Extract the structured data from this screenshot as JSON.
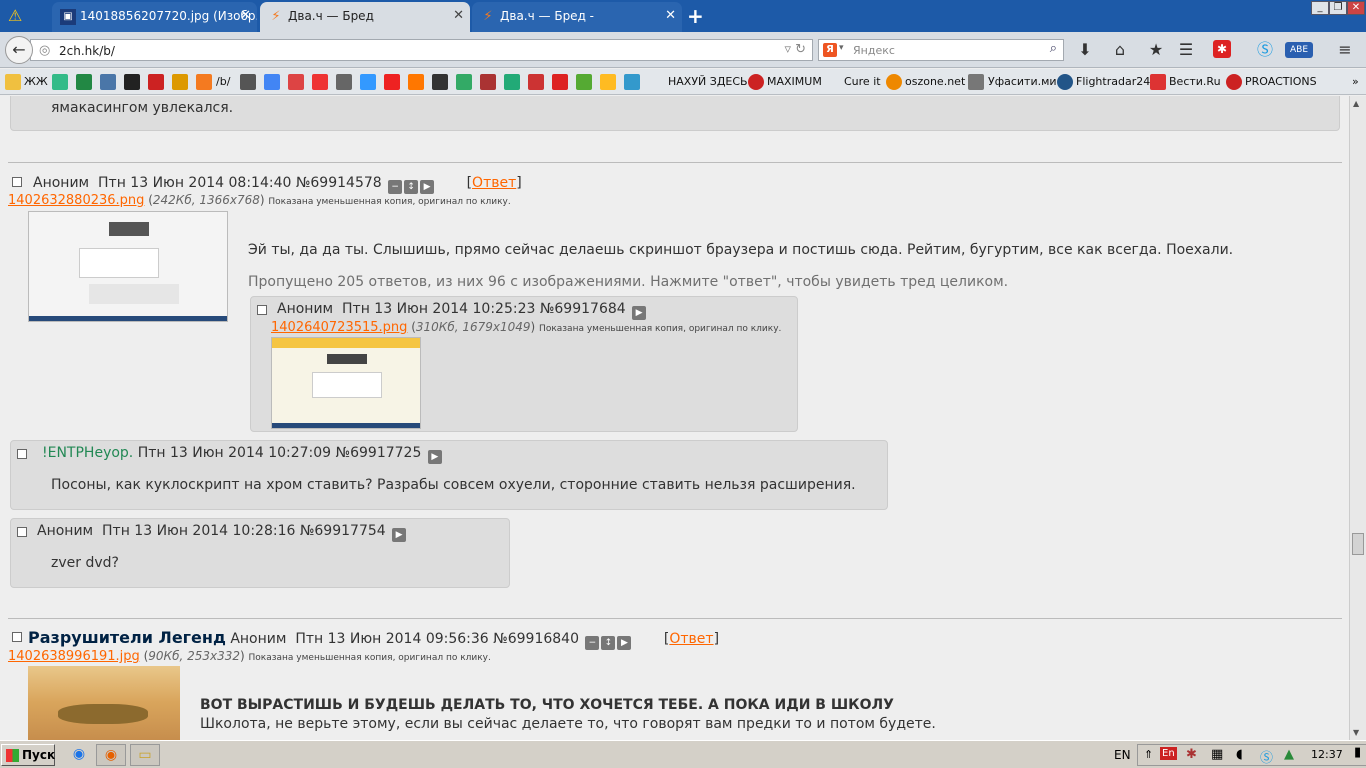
{
  "browser": {
    "tabs": [
      {
        "title": "14018856207720.jpg (Изобр...",
        "icon": "image-tab-icon",
        "active": false
      },
      {
        "title": "Два.ч — Бред",
        "icon": "2ch-tab-icon",
        "active": true
      },
      {
        "title": "Два.ч — Бред -",
        "icon": "2ch-tab-icon",
        "active": false
      }
    ],
    "new_tab_label": "+",
    "url": "2ch.hk/b/",
    "search_placeholder": "Яндекс",
    "search_engine_letter": "Я",
    "bookmarks": [
      "ЖЖ",
      "/b/",
      "НАХУЙ ЗДЕСЬ",
      "MAXIMUM",
      "Cure it",
      "oszone.net",
      "Уфасити.ми",
      "Flightradar24",
      "Вести.Ru",
      "PROACTIONS"
    ],
    "back_arrow": "←",
    "window_buttons": [
      "_",
      "❐",
      "✕"
    ]
  },
  "threads": [
    {
      "top_text": "ямакасингом увлекался.",
      "op": {
        "poster": "Аноним",
        "date": "Птн 13 Июн 2014 08:14:40",
        "num": "№69914578",
        "answer_open": "[",
        "answer_link": "Ответ",
        "answer_close": "]",
        "file_name": "1402632880236.png",
        "file_info": "242Кб, 1366x768",
        "file_note": "Показана уменьшенная копия, оригинал по клику.",
        "text": "Эй ты, да да ты. Слышишь, прямо сейчас делаешь скриншот браузера и постишь сюда. Рейтим, бугуртим, все как всегда. Поехали.",
        "omitted": "Пропущено 205 ответов, из них 96 с изображениями. Нажмите \"ответ\", чтобы увидеть тред целиком."
      },
      "replies": [
        {
          "poster": "Аноним",
          "date": "Птн 13 Июн 2014 10:25:23",
          "num": "№69917684",
          "file_name": "1402640723515.png",
          "file_info": "310Кб, 1679x1049",
          "file_note": "Показана уменьшенная копия, оригинал по клику."
        },
        {
          "poster": "!ENTPHeyop.",
          "date": "Птн 13 Июн 2014 10:27:09",
          "num": "№69917725",
          "text": "Посоны, как куклоскрипт на хром ставить? Разрабы совсем охуели, сторонние ставить нельзя расширения."
        },
        {
          "poster": "Аноним",
          "date": "Птн 13 Июн 2014 10:28:16",
          "num": "№69917754",
          "text": "zver dvd?"
        }
      ]
    },
    {
      "op": {
        "subject": "Разрушители Легенд",
        "poster": "Аноним",
        "date": "Птн 13 Июн 2014 09:56:36",
        "num": "№69916840",
        "answer_open": "[",
        "answer_link": "Ответ",
        "answer_close": "]",
        "file_name": "1402638996191.jpg",
        "file_info": "90Кб, 253x332",
        "file_note": "Показана уменьшенная копия, оригинал по клику.",
        "text_bold": "ВОТ ВЫРАСТИШЬ И БУДЕШЬ ДЕЛАТЬ ТО, ЧТО ХОЧЕТСЯ ТЕБЕ. А ПОКА ИДИ В ШКОЛУ",
        "text": "Школота, не верьте этому, если вы сейчас делаете то, что говорят вам предки то и потом будете."
      }
    }
  ],
  "taskbar": {
    "start_label": "Пуск",
    "lang": "EN",
    "clock": "12:37",
    "tray_lang": "En"
  }
}
